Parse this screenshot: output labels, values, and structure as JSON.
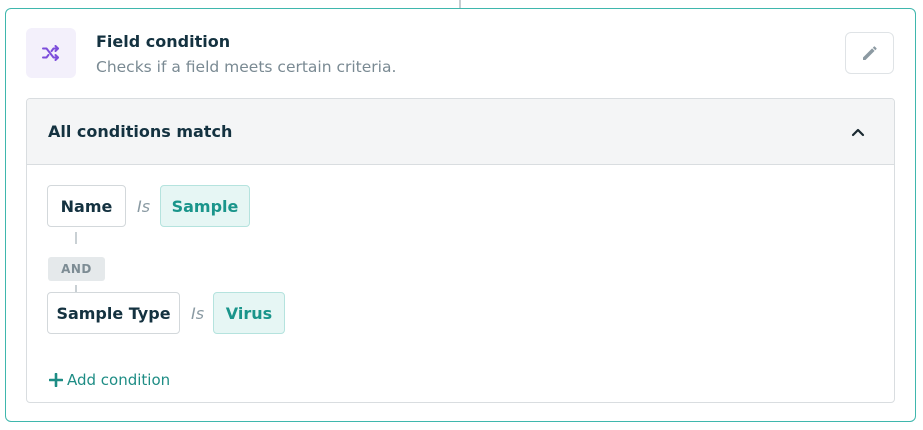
{
  "step": {
    "title": "Field condition",
    "subtitle": "Checks if a field meets certain criteria.",
    "icon": "shuffle-icon",
    "accent_color": "#7c4ddb"
  },
  "group": {
    "label": "All conditions match",
    "toggle_icon": "chevron-up-icon"
  },
  "conditions": [
    {
      "field": "Name",
      "operator": "Is",
      "value": "Sample"
    },
    {
      "field": "Sample Type",
      "operator": "Is",
      "value": "Virus"
    }
  ],
  "joiner": "AND",
  "add_condition": {
    "label": "Add condition",
    "icon": "plus-icon"
  },
  "colors": {
    "border": "#3fb7ad",
    "value_text": "#1a958b",
    "value_bg": "#e6f6f4",
    "link": "#1e8d85"
  }
}
